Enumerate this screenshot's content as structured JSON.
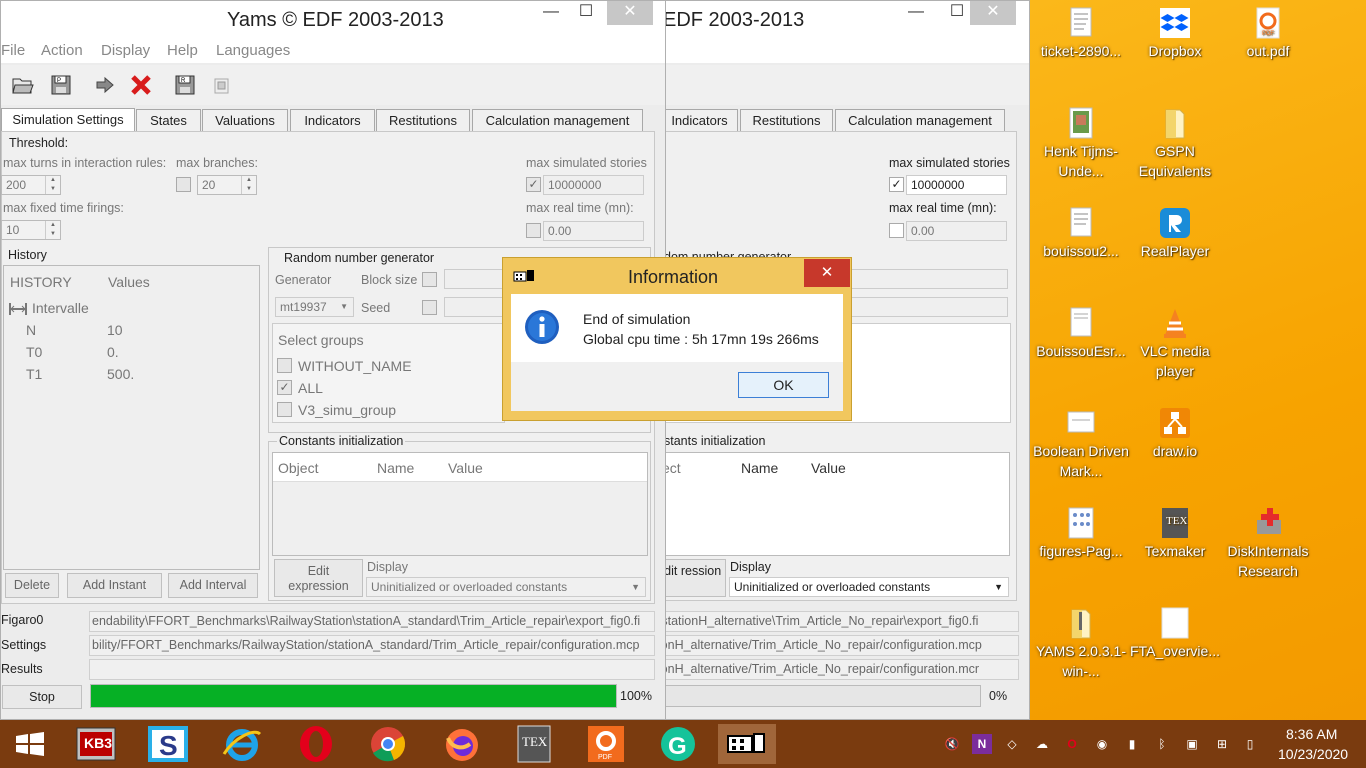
{
  "desktop_icons": [
    {
      "label": "ticket-2890...",
      "icon": "document-icon"
    },
    {
      "label": "Dropbox",
      "icon": "dropbox-icon"
    },
    {
      "label": "out.pdf",
      "icon": "pdf-icon"
    },
    {
      "label": "Henk Tijms-Unde...",
      "icon": "book-icon"
    },
    {
      "label": "GSPN Equivalents",
      "icon": "folder-icon"
    },
    {
      "label": "bouissou2...",
      "icon": "document-icon"
    },
    {
      "label": "RealPlayer",
      "icon": "realplayer-icon"
    },
    {
      "label": "BouissouEsr...",
      "icon": "document-icon"
    },
    {
      "label": "VLC media player",
      "icon": "vlc-icon"
    },
    {
      "label": "Boolean Driven Mark...",
      "icon": "document-icon"
    },
    {
      "label": "draw.io",
      "icon": "drawio-icon"
    },
    {
      "label": "figures-Pag...",
      "icon": "document-icon"
    },
    {
      "label": "Texmaker",
      "icon": "texmaker-icon"
    },
    {
      "label": "DiskInternals Research",
      "icon": "diskinternals-icon"
    },
    {
      "label": "YAMS 2.0.3.1-win-...",
      "icon": "zip-folder-icon"
    },
    {
      "label": "FTA_overvie...",
      "icon": "document-icon"
    }
  ],
  "win1": {
    "title": "Yams © EDF 2003-2013",
    "menu": [
      "File",
      "Action",
      "Display",
      "Help",
      "Languages"
    ],
    "tabs": [
      "Simulation Settings",
      "States",
      "Valuations",
      "Indicators",
      "Restitutions",
      "Calculation management"
    ],
    "threshold_label": "Threshold:",
    "max_turns_label": "max turns in interaction rules:",
    "max_turns_value": "200",
    "max_branches_label": "max branches:",
    "max_branches_value": "20",
    "max_stories_label": "max simulated stories",
    "max_stories_value": "10000000",
    "max_fixed_label": "max fixed time firings:",
    "max_fixed_value": "10",
    "max_real_label": "max real time (mn):",
    "max_real_value": "0.00",
    "history_title": "History",
    "history_cols": [
      "HISTORY",
      "Values"
    ],
    "history_group": "Intervalle",
    "history_rows": [
      {
        "k": "N",
        "v": "10"
      },
      {
        "k": "T0",
        "v": "0."
      },
      {
        "k": "T1",
        "v": "500."
      }
    ],
    "history_buttons": [
      "Delete",
      "Add Instant",
      "Add Interval"
    ],
    "rng_title": "Random number generator",
    "rng_generator_label": "Generator",
    "rng_generator_value": "mt19937",
    "rng_block_label": "Block size",
    "rng_seed_label": "Seed",
    "groups_title": "Select groups",
    "groups": [
      {
        "name": "WITHOUT_NAME",
        "checked": ""
      },
      {
        "name": "ALL",
        "checked": "✓"
      },
      {
        "name": "V3_simu_group",
        "checked": ""
      }
    ],
    "const_title": "Constants initialization",
    "const_cols": [
      "Object",
      "Name",
      "Value"
    ],
    "edit_expression": "Edit expression",
    "display_label": "Display",
    "display_value": "Uninitialized or overloaded constants",
    "path_labels": [
      "Figaro0",
      "Settings",
      "Results"
    ],
    "paths": [
      "endability\\FFORT_Benchmarks\\RailwayStation\\stationA_standard\\Trim_Article_repair\\export_fig0.fi",
      "bility/FFORT_Benchmarks/RailwayStation/stationA_standard/Trim_Article_repair/configuration.mcp",
      ""
    ],
    "stop_label": "Stop",
    "progress": 1.0,
    "progress_text": "100%"
  },
  "win2": {
    "title": "EDF 2003-2013",
    "tabs": [
      "Indicators",
      "Restitutions",
      "Calculation management"
    ],
    "max_stories_label": "max simulated stories",
    "max_stories_value": "10000000",
    "max_real_label": "max real time (mn):",
    "max_real_value": "0.00",
    "rng_title": "dom number generator",
    "const_title": "stants initialization",
    "const_cols": [
      "ect",
      "Name",
      "Value"
    ],
    "edit_expression": "Edit ression",
    "display_label": "Display",
    "display_value": "Uninitialized or overloaded constants",
    "paths": [
      "on\\stationH_alternative\\Trim_Article_No_repair\\export_fig0.fi",
      "tationH_alternative/Trim_Article_No_repair/configuration.mcp",
      "tationH_alternative/Trim_Article_No_repair/configuration.mcr"
    ],
    "progress": 0.0,
    "progress_text": "0%"
  },
  "dialog": {
    "title": "Information",
    "line1": "End of simulation",
    "line2": "Global cpu time : 5h 17mn 19s 266ms",
    "ok": "OK"
  },
  "taskbar": {
    "apps": [
      "start-icon",
      "kb3-icon",
      "s-app-icon",
      "internet-explorer-icon",
      "opera-icon",
      "chrome-icon",
      "firefox-icon",
      "texmaker-icon",
      "pdf-icon",
      "grammarly-icon",
      "yams-icon"
    ],
    "kb3_label": "KB3",
    "tray": [
      "volume-muted-icon",
      "onenote-icon",
      "dropbox-tray-icon",
      "chat-icon",
      "opera-tray-icon",
      "updates-icon",
      "battery-warning-icon",
      "bluetooth-icon",
      "display-icon",
      "network-icon",
      "power-icon"
    ],
    "time": "8:36 AM",
    "date": "10/23/2020"
  }
}
